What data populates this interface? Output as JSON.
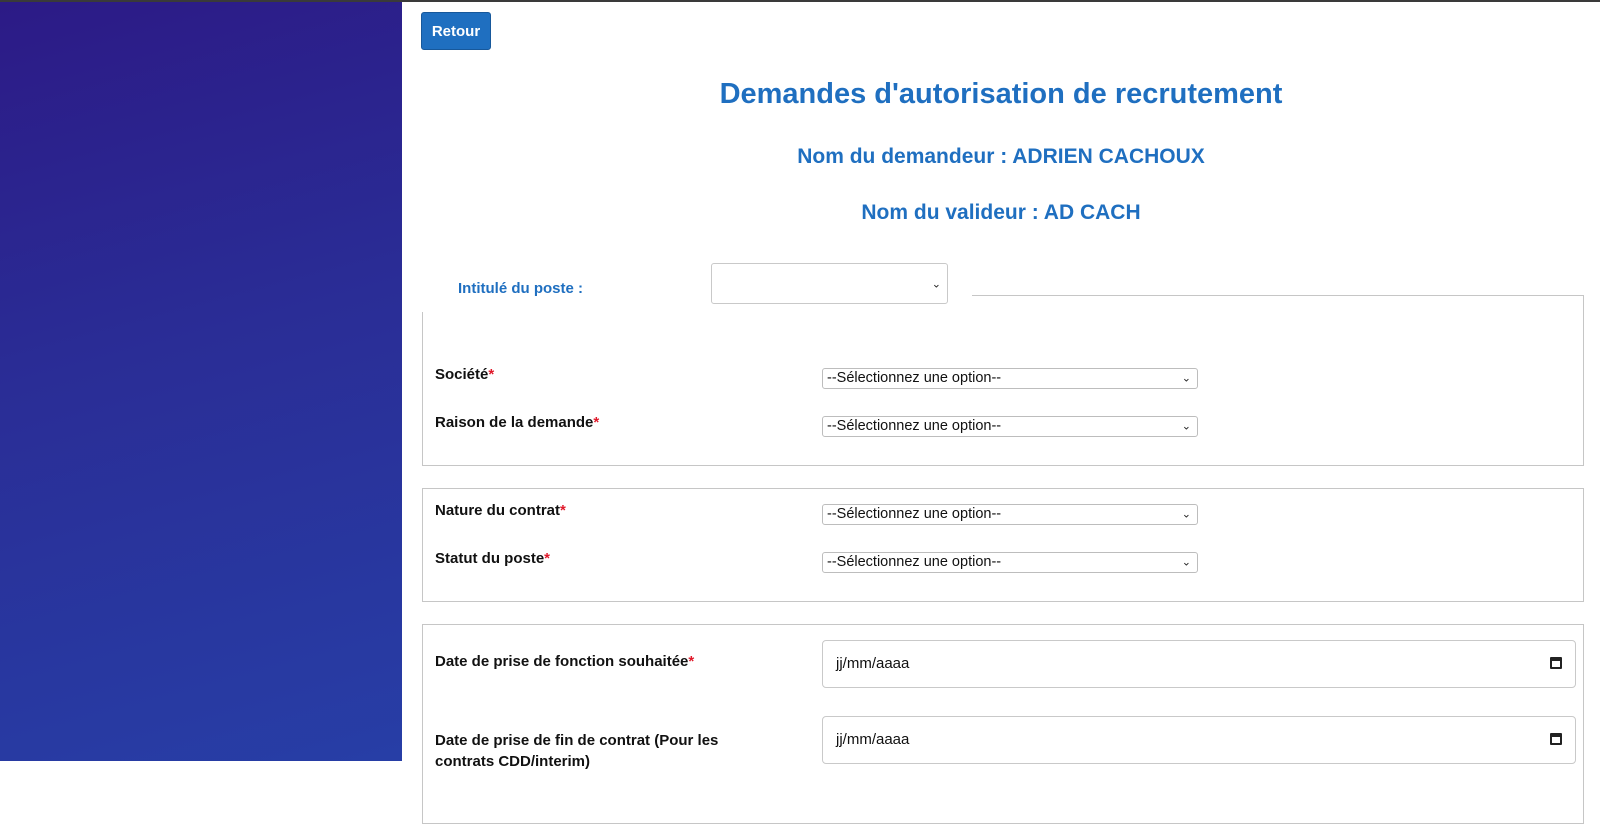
{
  "header": {
    "back_label": "Retour"
  },
  "page": {
    "title": "Demandes d'autorisation de recrutement",
    "requester": "Nom du demandeur : ADRIEN CACHOUX",
    "validator": "Nom du valideur : AD CACH"
  },
  "job_title": {
    "label": "Intitulé du poste :",
    "value": ""
  },
  "section1": {
    "company": {
      "label": "Société",
      "value": "--Sélectionnez une option--"
    },
    "reason": {
      "label": "Raison de la demande",
      "value": "--Sélectionnez une option--"
    }
  },
  "section2": {
    "contract_type": {
      "label": "Nature du contrat",
      "value": "--Sélectionnez une option--"
    },
    "job_status": {
      "label": "Statut du poste",
      "value": "--Sélectionnez une option--"
    }
  },
  "section3": {
    "start_date": {
      "label": "Date de prise de fonction souhaitée",
      "value": "jj/mm/aaaa"
    },
    "end_date": {
      "label": "Date de prise de fin de contrat (Pour les contrats CDD/interim)",
      "value": "jj/mm/aaaa"
    }
  },
  "required_mark": "*",
  "colors": {
    "accent": "#1f6fc0",
    "required": "#e0192a",
    "sidebar_top": "#2c1a86",
    "sidebar_bottom": "#273ea6"
  }
}
